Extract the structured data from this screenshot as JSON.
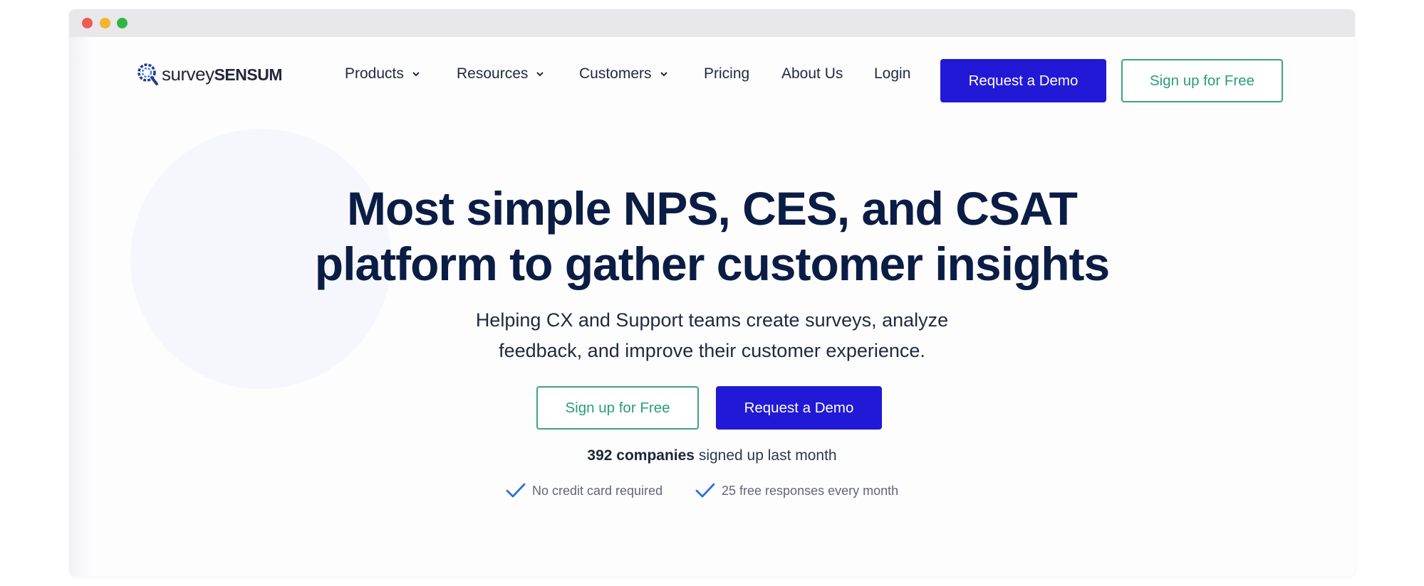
{
  "window": {
    "controls": [
      "close",
      "minimize",
      "maximize"
    ],
    "control_colors": {
      "close": "#ee5b52",
      "minimize": "#f2b52d",
      "maximize": "#2fb645"
    }
  },
  "brand": {
    "logo_icon": "surveysensum-logo-icon",
    "name_part1": "survey",
    "name_part2": "SENSUM"
  },
  "nav": {
    "items": [
      {
        "label": "Products",
        "dropdown": true
      },
      {
        "label": "Resources",
        "dropdown": true
      },
      {
        "label": "Customers",
        "dropdown": true
      },
      {
        "label": "Pricing",
        "dropdown": false
      },
      {
        "label": "About Us",
        "dropdown": false
      },
      {
        "label": "Login",
        "dropdown": false
      }
    ],
    "demo_button": "Request a Demo",
    "signup_button": "Sign up for Free"
  },
  "hero": {
    "headline_line1": "Most simple NPS, CES, and CSAT",
    "headline_line2": "platform to gather customer insights",
    "subhead_line1": "Helping CX and Support teams create surveys, analyze",
    "subhead_line2": "feedback, and improve their customer experience.",
    "signup_button": "Sign up for Free",
    "demo_button": "Request a Demo",
    "companies_count": "392 companies",
    "companies_suffix": " signed up last month",
    "features": [
      {
        "icon": "check-icon",
        "label": "No credit card required"
      },
      {
        "icon": "check-icon",
        "label": "25 free responses every month"
      }
    ]
  },
  "colors": {
    "primary": "#2119d6",
    "accent_green": "#2a9c7c",
    "heading": "#0b1d45",
    "check": "#2f6fdc"
  }
}
